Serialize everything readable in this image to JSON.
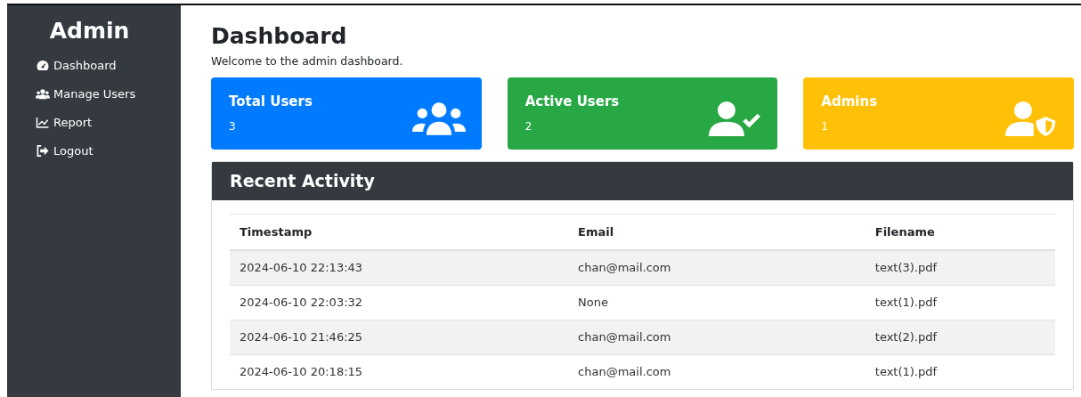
{
  "sidebar": {
    "title": "Admin",
    "items": [
      {
        "label": "Dashboard"
      },
      {
        "label": "Manage Users"
      },
      {
        "label": "Report"
      },
      {
        "label": "Logout"
      }
    ]
  },
  "page": {
    "title": "Dashboard",
    "subtitle": "Welcome to the admin dashboard."
  },
  "cards": [
    {
      "title": "Total Users",
      "value": "3",
      "color": "#007bff"
    },
    {
      "title": "Active Users",
      "value": "2",
      "color": "#28a745"
    },
    {
      "title": "Admins",
      "value": "1",
      "color": "#ffc107"
    }
  ],
  "activity": {
    "title": "Recent Activity",
    "columns": [
      "Timestamp",
      "Email",
      "Filename"
    ],
    "rows": [
      [
        "2024-06-10 22:13:43",
        "chan@mail.com",
        "text(3).pdf"
      ],
      [
        "2024-06-10 22:03:32",
        "None",
        "text(1).pdf"
      ],
      [
        "2024-06-10 21:46:25",
        "chan@mail.com",
        "text(2).pdf"
      ],
      [
        "2024-06-10 20:18:15",
        "chan@mail.com",
        "text(1).pdf"
      ]
    ]
  }
}
